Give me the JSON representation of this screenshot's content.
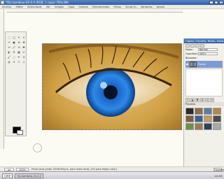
{
  "window": {
    "title": "*Olo bambino-02-0.0 (RGB, 1 capa) 700x390",
    "min_label": "_",
    "max_label": "□",
    "close_label": "x"
  },
  "menu": [
    "Archivo",
    "Editar",
    "Seleccionar",
    "Ver",
    "Imagen",
    "Capa",
    "Colores",
    "Herramientas",
    "Filtros",
    "Script-Fu",
    "Ventanas",
    "Ayuda"
  ],
  "tools": [
    "⬚",
    "◯",
    "✎",
    "⌖",
    "✂",
    "▣",
    "⊕",
    "✥",
    "↔",
    "⤢",
    "⟲",
    "✚",
    "◐",
    "A",
    "▦",
    "✏",
    "🖌",
    "◌",
    "✒",
    "⊘",
    "◍",
    "✦",
    "☼",
    "◇"
  ],
  "statusbar": {
    "unit": "px",
    "zoom": "100%",
    "text": "Pulse para pintar (Shift Mayús. para línea recta, Ctrl para elegir color)",
    "cancel": "Cancelar"
  },
  "layers_dock": {
    "title": "Capas, Canales, Rutas, Deshacer",
    "mode_label": "Modo:",
    "mode_value": "Normal",
    "opacity_label": "Opacidad:",
    "opacity_value": "100,0",
    "lock_label": "Bloquear:",
    "layer_name": "Fondo",
    "brushes_title": "Pinceles"
  },
  "taskbar": {
    "items": [
      "GIMP",
      "Olo bambino-02-0.0"
    ],
    "clock": "14:26"
  },
  "colors": {
    "title_blue": "#2f5da5",
    "selected_layer": "#7e9bd1",
    "canvas_bg": "#fbfbf4"
  }
}
